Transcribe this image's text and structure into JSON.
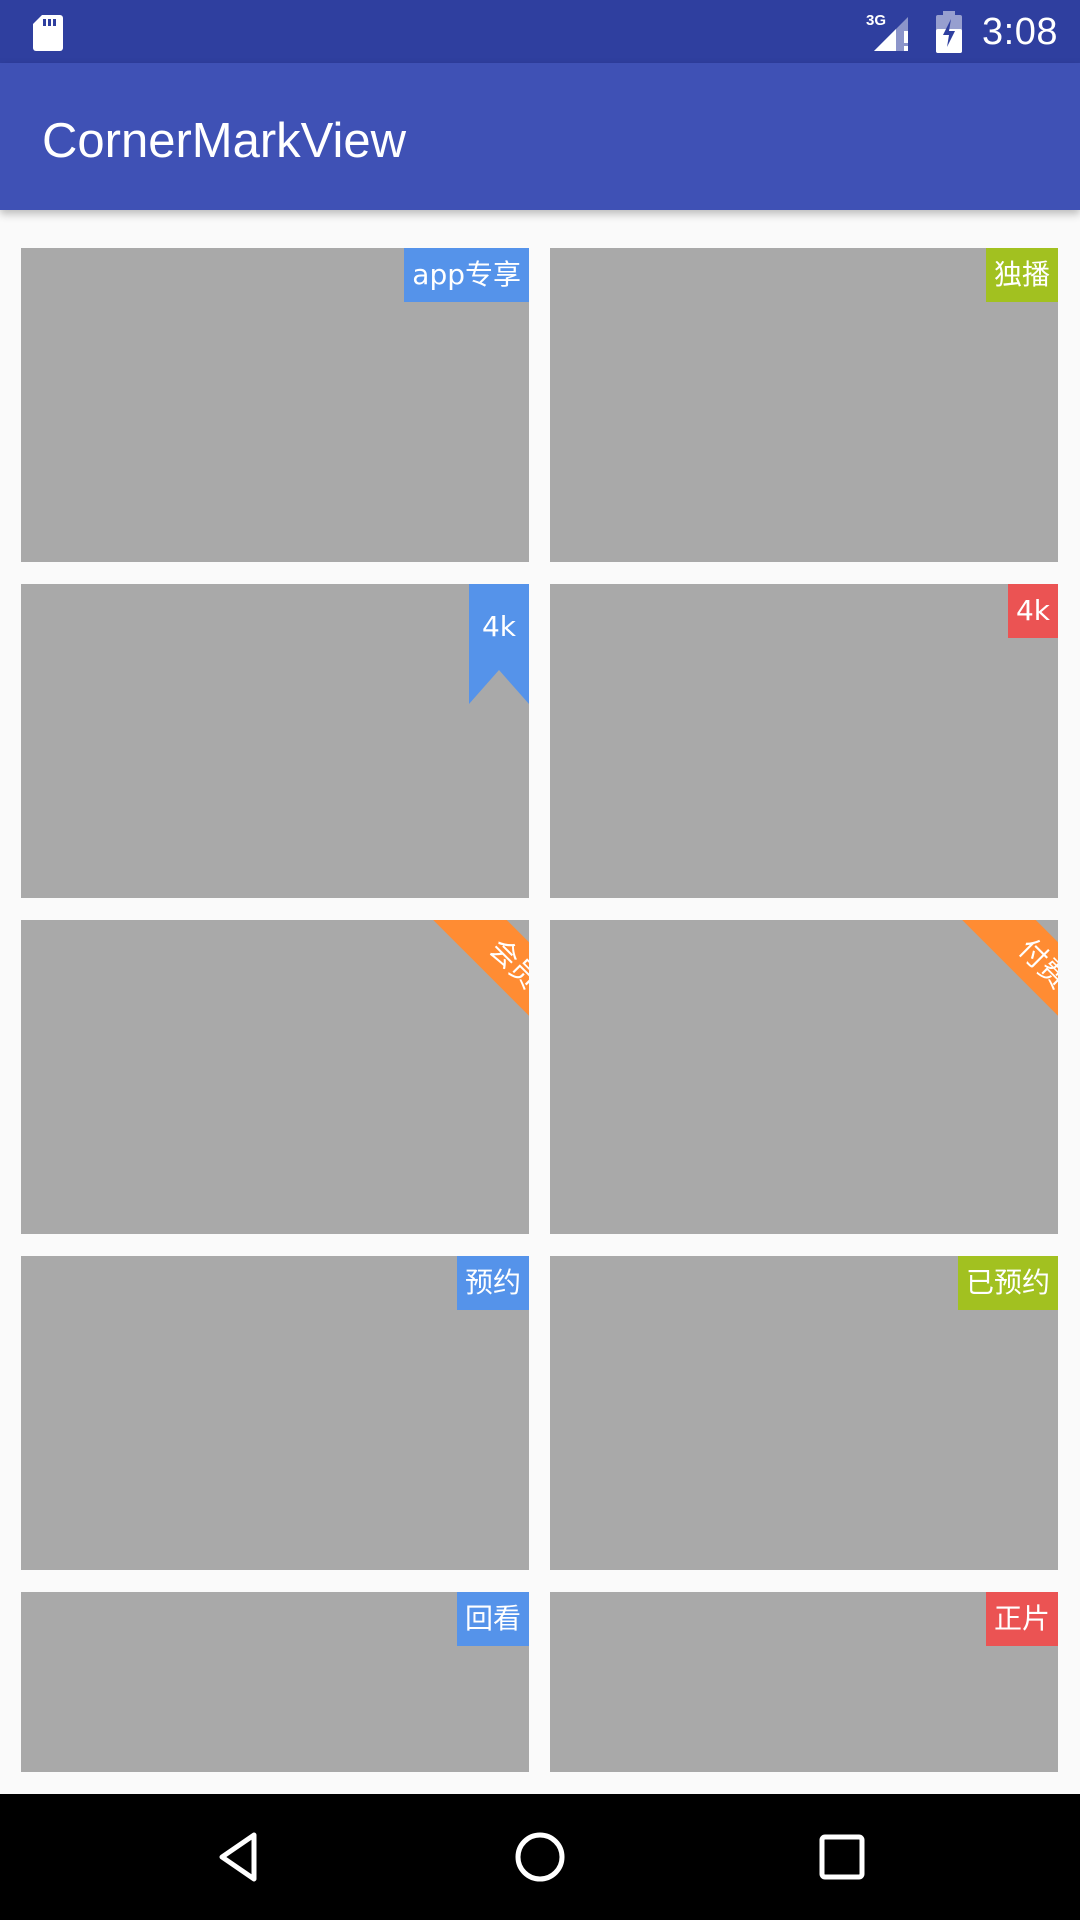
{
  "status_bar": {
    "time": "3:08",
    "network_label": "3G",
    "icons": [
      "sd-card-icon",
      "signal-3g-icon",
      "battery-charging-icon"
    ]
  },
  "app_bar": {
    "title": "CornerMarkView"
  },
  "colors": {
    "status_bar": "#2f3f9f",
    "app_bar": "#3f51b5",
    "card": "#a9a9a9",
    "blue": "#5593ea",
    "green": "#a2c120",
    "red": "#eb5353",
    "orange": "#ff8c33"
  },
  "cards": [
    {
      "mark": "app专享",
      "style": "tag",
      "color": "blue"
    },
    {
      "mark": "独播",
      "style": "tag",
      "color": "green"
    },
    {
      "mark": "4k",
      "style": "bookmark",
      "color": "blue"
    },
    {
      "mark": "4k",
      "style": "tag",
      "color": "red"
    },
    {
      "mark": "会员",
      "style": "ribbon",
      "color": "orange"
    },
    {
      "mark": "付费",
      "style": "ribbon",
      "color": "orange"
    },
    {
      "mark": "预约",
      "style": "tag",
      "color": "blue"
    },
    {
      "mark": "已预约",
      "style": "tag",
      "color": "green"
    },
    {
      "mark": "回看",
      "style": "tag",
      "color": "blue"
    },
    {
      "mark": "正片",
      "style": "tag",
      "color": "red"
    }
  ],
  "nav_bar": {
    "icons": [
      "back-icon",
      "home-icon",
      "recents-icon"
    ]
  }
}
